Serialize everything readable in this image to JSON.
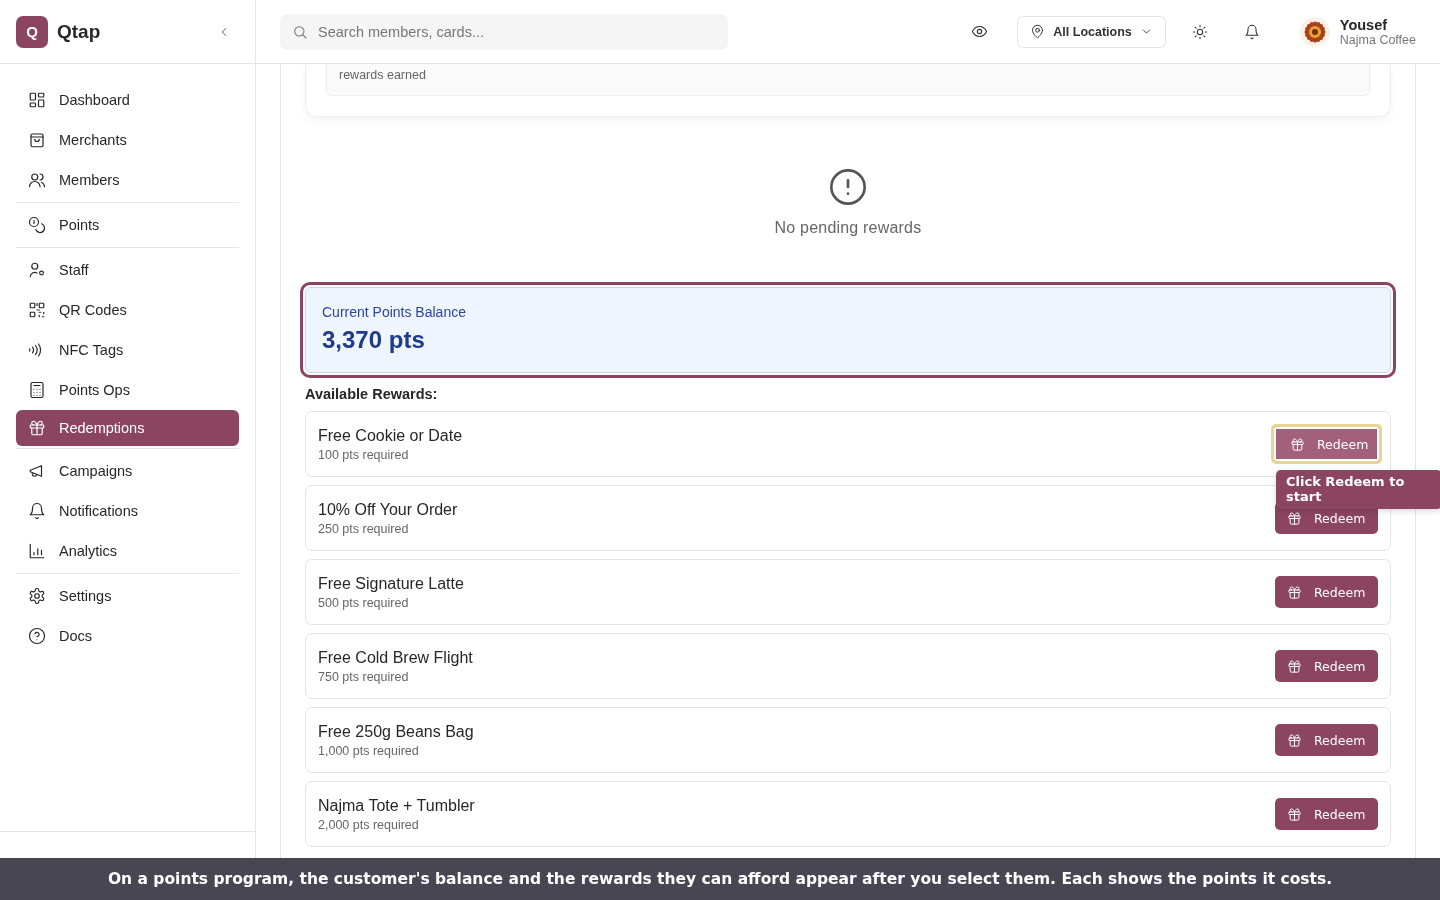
{
  "app": {
    "logo_letter": "Q",
    "name": "Qtap"
  },
  "sidebar": {
    "groups": [
      [
        {
          "label": "Dashboard",
          "selected": false
        },
        {
          "label": "Merchants",
          "selected": false
        },
        {
          "label": "Members",
          "selected": false
        }
      ],
      [
        {
          "label": "Points",
          "selected": false
        }
      ],
      [
        {
          "label": "Staff",
          "selected": false
        },
        {
          "label": "QR Codes",
          "selected": false
        },
        {
          "label": "NFC Tags",
          "selected": false
        },
        {
          "label": "Points Ops",
          "selected": false
        },
        {
          "label": "Redemptions",
          "selected": true
        }
      ],
      [
        {
          "label": "Campaigns",
          "selected": false
        },
        {
          "label": "Notifications",
          "selected": false
        },
        {
          "label": "Analytics",
          "selected": false
        }
      ],
      [
        {
          "label": "Settings",
          "selected": false
        },
        {
          "label": "Docs",
          "selected": false
        }
      ]
    ]
  },
  "header": {
    "search": {
      "placeholder": "Search members, cards..."
    },
    "location": "All Locations",
    "user": {
      "name": "Yousef",
      "org": "Najma Coffee"
    }
  },
  "summary_card": {
    "caption": "rewards earned"
  },
  "empty_state": {
    "message": "No pending rewards"
  },
  "balance": {
    "label": "Current Points Balance",
    "value": "3,370 pts",
    "highlighted": true
  },
  "rewards_heading": "Available Rewards:",
  "rewards": [
    {
      "name": "Free Cookie or Date",
      "cost": "100 pts required",
      "button": "Redeem",
      "highlighted": true
    },
    {
      "name": "10% Off Your Order",
      "cost": "250 pts required",
      "button": "Redeem",
      "highlighted": false
    },
    {
      "name": "Free Signature Latte",
      "cost": "500 pts required",
      "button": "Redeem",
      "highlighted": false
    },
    {
      "name": "Free Cold Brew Flight",
      "cost": "750 pts required",
      "button": "Redeem",
      "highlighted": false
    },
    {
      "name": "Free 250g Beans Bag",
      "cost": "1,000 pts required",
      "button": "Redeem",
      "highlighted": false
    },
    {
      "name": "Najma Tote + Tumbler",
      "cost": "2,000 pts required",
      "button": "Redeem",
      "highlighted": false
    }
  ],
  "tooltip": {
    "text": "Click Redeem to start"
  },
  "caption": "On a points program, the customer's balance and the rewards they can afford appear after you select them. Each shows the points it costs."
}
